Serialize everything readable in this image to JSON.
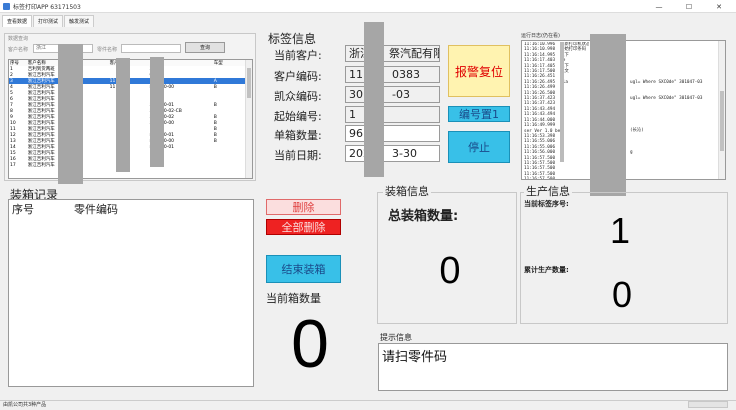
{
  "window": {
    "title": "标签打印APP 63171503"
  },
  "tabs": [
    "查看数据",
    "打印测试",
    "触发测试"
  ],
  "query": {
    "group": "数据查询",
    "customer_name_label": "客户名称",
    "customer_value": "浙江",
    "part_label": "零件名称",
    "query_button": "查询"
  },
  "grid": {
    "headers": [
      "序号",
      "客户名称",
      "",
      "客户",
      "",
      "车型"
    ],
    "rows": [
      [
        "1",
        "吉利到货两班",
        "",
        "",
        "3001",
        ""
      ],
      [
        "2",
        "浙江吉利汽车",
        "",
        "",
        "0",
        ""
      ],
      [
        "3",
        "浙江吉利汽车",
        "(1)",
        "11",
        "",
        "A"
      ],
      [
        "4",
        "浙江吉利汽车",
        "",
        "11",
        "800000-00",
        "B"
      ],
      [
        "5",
        "浙江吉利汽车",
        "",
        "",
        "",
        ""
      ],
      [
        "6",
        "浙江吉利汽车",
        "",
        "",
        "",
        ""
      ],
      [
        "7",
        "浙江吉利汽车",
        "",
        "",
        "500000-01",
        "B"
      ],
      [
        "8",
        "浙江吉利汽车",
        "",
        "",
        "500000-02-CB",
        ""
      ],
      [
        "9",
        "浙江吉利汽车",
        "",
        "",
        "500000-02",
        "B"
      ],
      [
        "10",
        "浙江吉利汽车",
        "",
        "",
        "500000-00",
        "B"
      ],
      [
        "11",
        "浙江吉利汽车",
        "",
        "",
        "",
        "B"
      ],
      [
        "12",
        "浙江吉利汽车",
        "",
        "",
        "800000-01",
        "B"
      ],
      [
        "13",
        "浙江吉利汽车",
        "",
        "",
        "800000-00",
        "B"
      ],
      [
        "14",
        "浙江吉利汽车",
        "",
        "",
        "800000-01",
        ""
      ],
      [
        "15",
        "浙江吉利汽车",
        "",
        "",
        "",
        ""
      ],
      [
        "16",
        "浙江吉利汽车",
        "",
        "",
        "",
        ""
      ],
      [
        "17",
        "浙江吉利汽车",
        "",
        "",
        "",
        ""
      ]
    ]
  },
  "label_info": {
    "title": "标签信息",
    "customer_label": "当前客户:",
    "customer_value": "浙江",
    "customer_value_tail": "祭汽配有限",
    "customer_code_label": "客户编码:",
    "customer_code_value": "111",
    "customer_code_tail": "0383",
    "kaizhong_code_label": "凯众编码:",
    "kaizhong_code_value": "301",
    "kaizhong_code_tail": "-03",
    "start_no_label": "起始编号:",
    "start_no_value": "1",
    "box_qty_label": "单箱数量:",
    "box_qty_value": "96",
    "date_label": "当前日期:",
    "date_value": "202",
    "date_tail": "3-30"
  },
  "buttons": {
    "alarm_reset": "报警复位",
    "number_reset": "编号置1",
    "stop": "停止",
    "delete": "删除",
    "delete_all": "全部删除",
    "end_packing": "结束装箱"
  },
  "log": {
    "title": "运行日志(仍在看)",
    "left_lines": [
      "11:16:10.996  更新打印机状态",
      "11:16:10.998  开始打印条码",
      "11:16:14.995  以下",
      "11:16:17.403  Fe",
      "11:16:17.405  以下",
      "11:16:17.500  从文",
      "11:16:26.451",
      "11:16:26.495  Pla",
      "11:16:26.499",
      "11:16:26.500",
      "11:16:37.423",
      "11:16:37.423",
      "11:16:43.494",
      "11:16:43.494",
      "11:16:44.000",
      "11:16:49.999",
      "ser Ver 1.0 ber",
      "11:16:53.398",
      "11:16:55.006",
      "11:16:55.006",
      "11:16:56.000",
      "11:16:57.500",
      "11:16:57.500",
      "11:16:57.500",
      "11:16:57.500",
      "11:16:57.500",
      "11:16:58.000",
      "11:16:58.000",
      "11:16:58.000",
      "11:16:59.000",
      "11:16:59.000"
    ],
    "right_lines": [
      "",
      "",
      "",
      "",
      "",
      "",
      "",
      "ugl= Where SXC0de\" 301047-03",
      "",
      "",
      "ugl= Where SXC0de\" 301047-03",
      "",
      "",
      "",
      "",
      "",
      "(长沁)",
      "",
      "",
      "",
      "g",
      "",
      "",
      "",
      "",
      "",
      "",
      "",
      "",
      "",
      ""
    ]
  },
  "packing_record": {
    "title": "装箱记录",
    "col_no": "序号",
    "col_part": "零件编码"
  },
  "current_box": {
    "label": "当前箱数量",
    "value": "0"
  },
  "packing_info": {
    "title": "装箱信息",
    "total_label": "总装箱数量:",
    "total_value": "0"
  },
  "production_info": {
    "title": "生产信息",
    "serial_label": "当前标签序号:",
    "serial_value": "1",
    "total_label": "累计生产数量:",
    "total_value": "0"
  },
  "prompt": {
    "title": "提示信息",
    "message": "请扫零件码"
  },
  "status_bar": {
    "text": "由凯公司共3种产品"
  },
  "colors": {
    "alarm_bg": "#fff3b0",
    "alarm_text": "#e00000",
    "cyan_btn": "#38c0e8",
    "red_btn": "#ee2222",
    "delete_bg": "#fbdede",
    "selection": "#3079d8"
  }
}
